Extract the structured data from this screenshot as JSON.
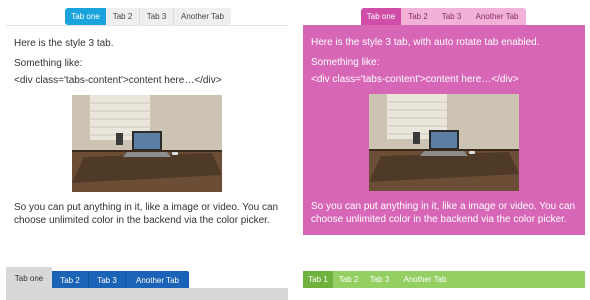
{
  "panel1": {
    "tabs": [
      {
        "label": "Tab one",
        "active": true
      },
      {
        "label": "Tab 2",
        "active": false
      },
      {
        "label": "Tab 3",
        "active": false
      },
      {
        "label": "Another Tab",
        "active": false
      }
    ],
    "line1": "Here is the style 3 tab.",
    "line2": "Something like:",
    "line3": "<div class='tabs-content'>content here…</div>",
    "line4": "So you can put anything in it, like a image or video. You can choose unlimited color in the backend via the color picker."
  },
  "panel2": {
    "tabs": [
      {
        "label": "Tab one",
        "active": true
      },
      {
        "label": "Tab 2",
        "active": false
      },
      {
        "label": "Tab 3",
        "active": false
      },
      {
        "label": "Another Tab",
        "active": false
      }
    ],
    "line1": "Here is the style 3 tab, with auto rotate tab enabled.",
    "line2": "Something like:",
    "line3": "<div class='tabs-content'>content here…</div>",
    "line4": "So you can put anything in it, like a image or video. You can choose unlimited color in the backend via the color picker."
  },
  "panel3": {
    "tabs": [
      {
        "label": "Tab one",
        "active": true
      },
      {
        "label": "Tab 2",
        "active": false
      },
      {
        "label": "Tab 3",
        "active": false
      },
      {
        "label": "Another Tab",
        "active": false
      }
    ]
  },
  "panel4": {
    "tabs": [
      {
        "label": "Tab 1",
        "active": true
      },
      {
        "label": "Tab 2",
        "active": false
      },
      {
        "label": "Tab 3",
        "active": false
      },
      {
        "label": "Another Tab",
        "active": false
      }
    ]
  },
  "colors": {
    "blue_accent": "#1aa3dc",
    "pink_panel": "#d766b6",
    "pink_active_tab": "#d04ea8",
    "dark_blue_tab": "#1a63b6",
    "green_bar": "#93cf62",
    "green_active": "#70b23e"
  }
}
